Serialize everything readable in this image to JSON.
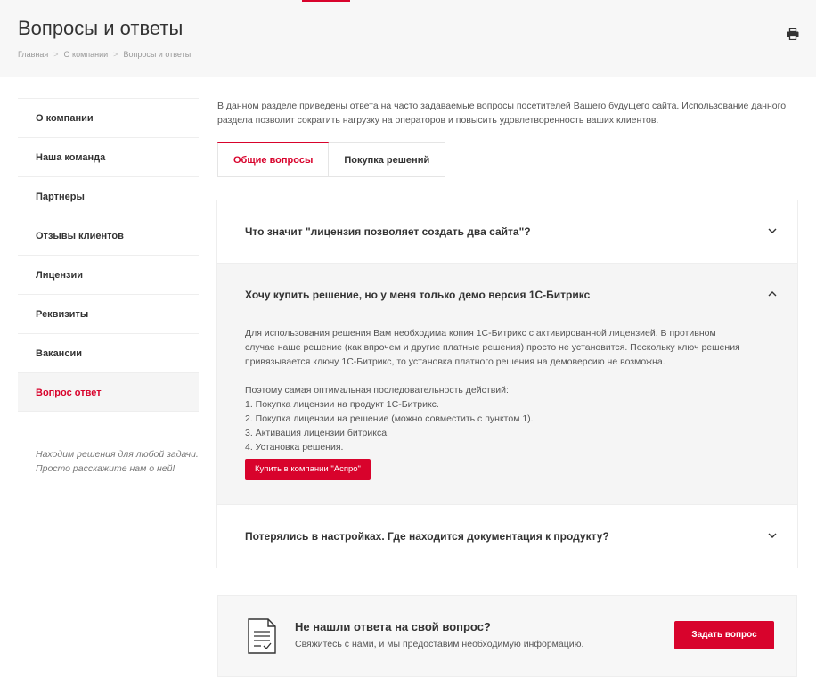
{
  "header": {
    "title": "Вопросы и ответы",
    "breadcrumbs": [
      "Главная",
      "О компании",
      "Вопросы и ответы"
    ],
    "print_icon": "printer-icon"
  },
  "sidebar": {
    "items": [
      {
        "label": "О компании",
        "active": false
      },
      {
        "label": "Наша команда",
        "active": false
      },
      {
        "label": "Партнеры",
        "active": false
      },
      {
        "label": "Отзывы клиентов",
        "active": false
      },
      {
        "label": "Лицензии",
        "active": false
      },
      {
        "label": "Реквизиты",
        "active": false
      },
      {
        "label": "Вакансии",
        "active": false
      },
      {
        "label": "Вопрос ответ",
        "active": true
      }
    ],
    "note_line1": "Находим решения для любой задачи.",
    "note_line2": "Просто расскажите нам о ней!"
  },
  "intro": "В данном разделе приведены ответа на часто задаваемые вопросы посетителей Вашего будущего сайта. Использование данного раздела позволит сократить нагрузку на операторов и повысить удовлетворенность ваших клиентов.",
  "tabs": [
    {
      "label": "Общие вопросы",
      "active": true
    },
    {
      "label": "Покупка решений",
      "active": false
    }
  ],
  "faq": [
    {
      "question": "Что значит \"лицензия позволяет создать два сайта\"?",
      "open": false
    },
    {
      "question": "Хочу купить решение, но у меня только демо версия 1С-Битрикс",
      "open": true,
      "answer_p1": "Для использования решения Вам необходима копия 1С-Битрикс с активированной лицензией. В противном случае наше решение (как впрочем и другие платные решения) просто не установится. Поскольку ключ решения привязывается ключу 1С-Битрикс, то установка платного решения на демоверсию не возможна.",
      "answer_intro": "Поэтому самая оптимальная последовательность действий:",
      "steps": [
        "1. Покупка лицензии на продукт 1С-Битрикс.",
        "2. Покупка лицензии на решение (можно совместить с пунктом 1).",
        "3. Активация лицензии битрикса.",
        "4. Установка решения."
      ],
      "button": "Купить в компании \"Аспро\""
    },
    {
      "question": "Потерялись в настройках. Где находится документация к продукту?",
      "open": false
    }
  ],
  "cta": {
    "icon": "document-check-icon",
    "title": "Не нашли ответа на свой вопрос?",
    "text": "Свяжитесь с нами, и мы предоставим необходимую информацию.",
    "button": "Задать вопрос"
  },
  "colors": {
    "accent": "#d8032c",
    "header_bg": "#f7f7f7",
    "open_item_bg": "#f5f5f5"
  }
}
